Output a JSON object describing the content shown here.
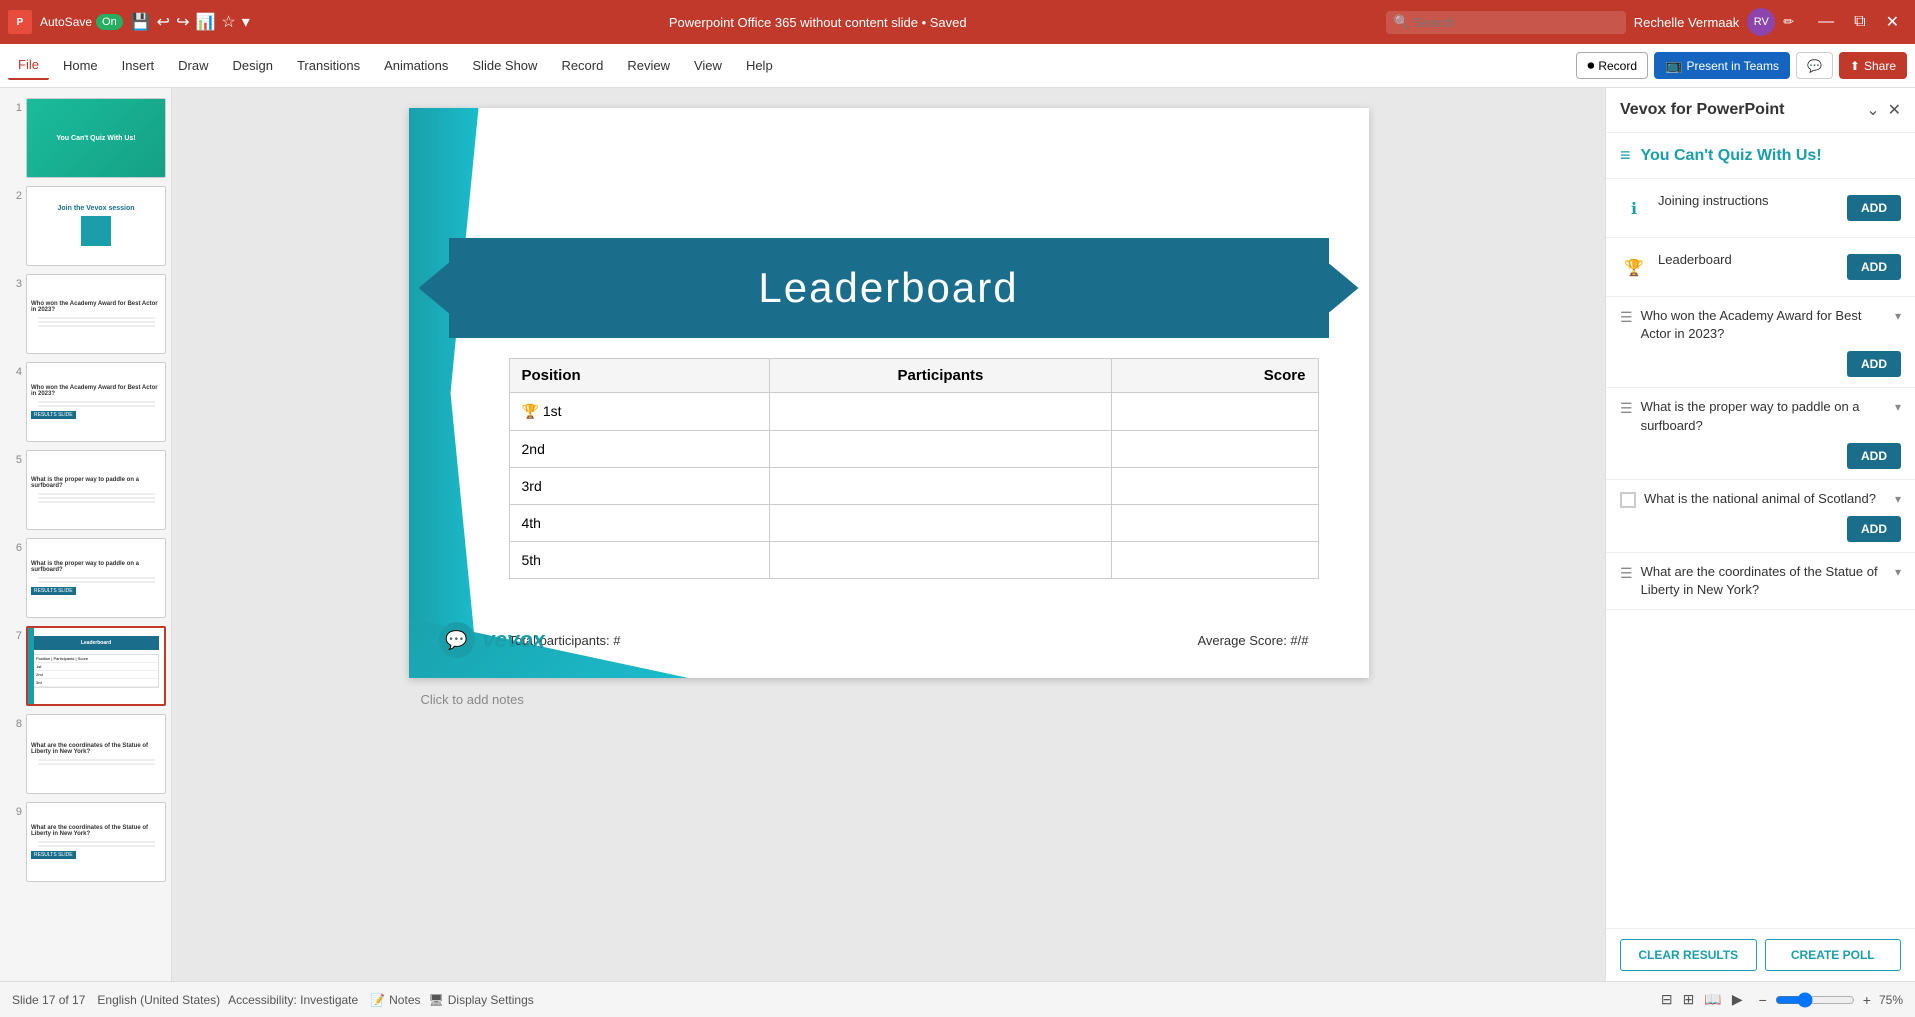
{
  "titlebar": {
    "autosave_label": "AutoSave",
    "toggle_label": "On",
    "file_title": "Powerpoint Office 365 without content slide • Saved",
    "search_placeholder": "Search",
    "user_name": "Rechelle Vermaak",
    "minimize": "—",
    "restore": "⧉",
    "close": "✕",
    "undo_icon": "↩",
    "redo_icon": "↪",
    "pen_icon": "✏"
  },
  "ribbon": {
    "tabs": [
      "File",
      "Home",
      "Insert",
      "Draw",
      "Design",
      "Transitions",
      "Animations",
      "Slide Show",
      "Record",
      "Review",
      "View",
      "Help"
    ],
    "active_tab": "Home",
    "record_label": "Record",
    "present_label": "Present in Teams",
    "share_label": "Share",
    "comment_icon": "💬",
    "share_icon": "⬆"
  },
  "slide_panel": {
    "slides": [
      {
        "num": 1,
        "type": "s1",
        "label": "You Can't Quiz With Us!"
      },
      {
        "num": 2,
        "type": "s2",
        "label": "Join the Vevox session"
      },
      {
        "num": 3,
        "type": "s3",
        "label": "Who won the Academy Award"
      },
      {
        "num": 4,
        "type": "s4",
        "label": "Who won the Academy Award"
      },
      {
        "num": 5,
        "type": "s5",
        "label": "What is the proper way to paddle"
      },
      {
        "num": 6,
        "type": "s6",
        "label": "What is the proper way to paddle"
      },
      {
        "num": 7,
        "type": "s7",
        "label": "Leaderboard"
      },
      {
        "num": 8,
        "type": "s8",
        "label": "What are the coordinates"
      },
      {
        "num": 9,
        "type": "s9",
        "label": "What are the coordinates"
      }
    ]
  },
  "slide_canvas": {
    "banner_text": "Leaderboard",
    "table": {
      "headers": [
        "Position",
        "Participants",
        "Score"
      ],
      "rows": [
        {
          "pos": "🏆 1st",
          "participants": "",
          "score": ""
        },
        {
          "pos": "2nd",
          "participants": "",
          "score": ""
        },
        {
          "pos": "3rd",
          "participants": "",
          "score": ""
        },
        {
          "pos": "4th",
          "participants": "",
          "score": ""
        },
        {
          "pos": "5th",
          "participants": "",
          "score": ""
        }
      ]
    },
    "footer_left": "Total participants: #",
    "footer_right": "Average Score: #/#",
    "logo_text": "vevox"
  },
  "notes_hint": "Click to add notes",
  "bottom_bar": {
    "notes_label": "Notes",
    "display_label": "Display Settings",
    "slide_info": "Slide 17 of 17",
    "language": "English (United States)",
    "accessibility": "Accessibility: Investigate",
    "zoom_level": "75%"
  },
  "vevox": {
    "title": "Vevox for PowerPoint",
    "quiz_title": "You Can't Quiz With Us!",
    "sections": [
      {
        "type": "info",
        "label": "Joining instructions",
        "has_add": true
      },
      {
        "type": "leaderboard",
        "label": "Leaderboard",
        "has_add": true
      }
    ],
    "questions": [
      {
        "label": "Who won the Academy Award for Best Actor in 2023?",
        "type": "list",
        "has_add": true,
        "has_chevron": true
      },
      {
        "label": "What is the proper way to paddle on a surfboard?",
        "type": "list",
        "has_add": true,
        "has_chevron": true
      },
      {
        "label": "What is the national animal of Scotland?",
        "type": "checkbox",
        "has_add": true,
        "has_chevron": true
      },
      {
        "label": "What are the coordinates of the Statue of Liberty in New York?",
        "type": "list",
        "has_add": false,
        "has_chevron": true
      }
    ],
    "footer": {
      "clear_label": "CLEAR RESULTS",
      "create_label": "CREATE POLL"
    }
  }
}
